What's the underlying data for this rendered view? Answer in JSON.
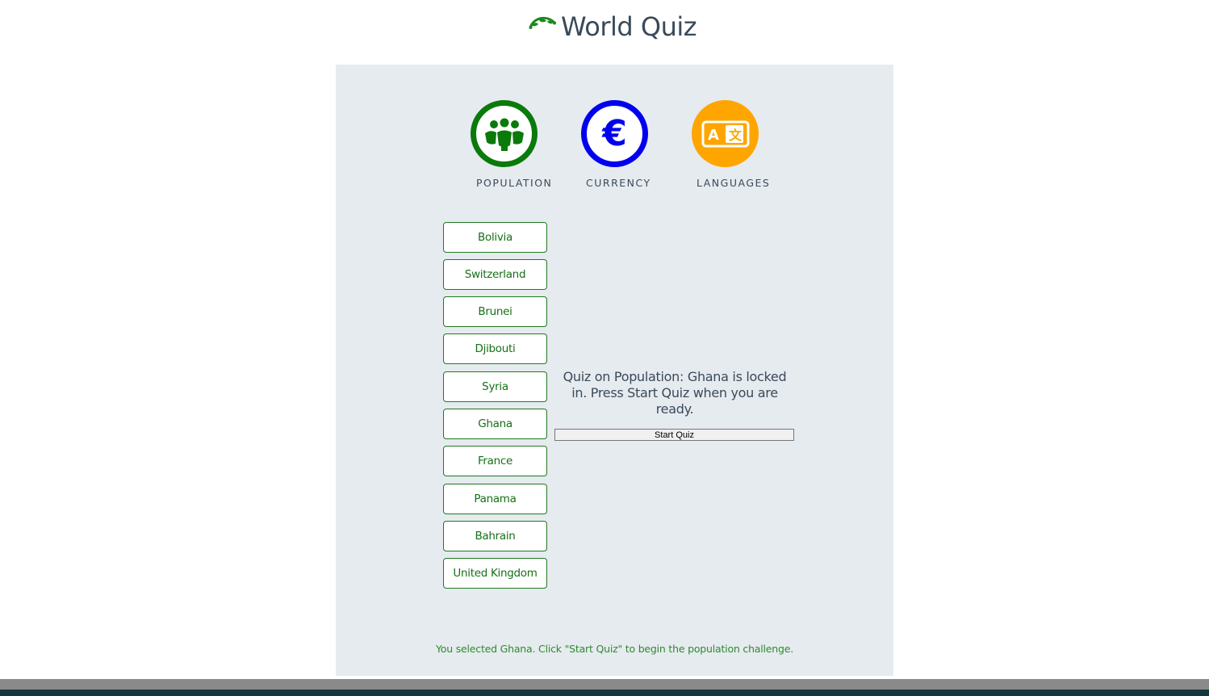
{
  "header": {
    "title": "World Quiz",
    "logo_icon": "globe-arc-icon"
  },
  "topics": [
    {
      "label": "POPULATION",
      "icon": "people-icon",
      "color": "#0a7a0a"
    },
    {
      "label": "CURRENCY",
      "icon": "euro-icon",
      "color": "#0000ee"
    },
    {
      "label": "LANGUAGES",
      "icon": "translate-icon",
      "color": "#ffa500"
    }
  ],
  "countries": [
    "Bolivia",
    "Switzerland",
    "Brunei",
    "Djibouti",
    "Syria",
    "Ghana",
    "France",
    "Panama",
    "Bahrain",
    "United Kingdom"
  ],
  "message": "Quiz on Population: Ghana is locked in. Press Start Quiz when you are ready.",
  "start_button": "Start Quiz",
  "status": "You selected Ghana. Click \"Start Quiz\" to begin the population challenge."
}
